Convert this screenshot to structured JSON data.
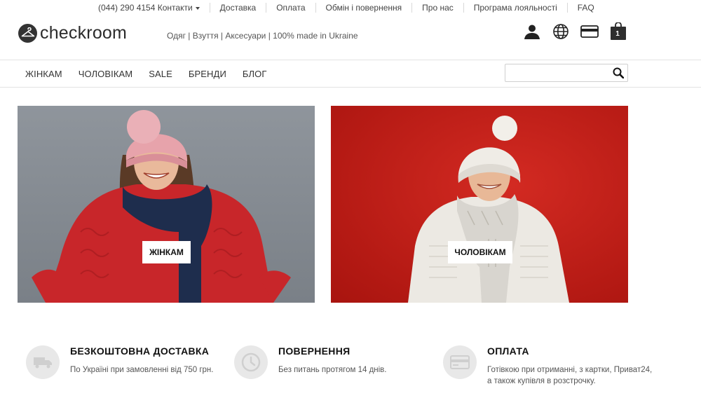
{
  "topbar": {
    "phone": "(044) 290 4154",
    "contacts": "Контакти",
    "links": [
      "Доставка",
      "Оплата",
      "Обмін і повернення",
      "Про нас",
      "Програма лояльності",
      "FAQ"
    ]
  },
  "header": {
    "logo_text": "checkroom",
    "tagline": "Одяг | Взуття | Аксесуари | 100% made in Ukraine",
    "cart_count": "1",
    "icons": [
      "user-icon",
      "globe-icon",
      "card-icon",
      "shopping-bag-icon"
    ]
  },
  "nav": {
    "items": [
      "ЖІНКАМ",
      "ЧОЛОВІКАМ",
      "SALE",
      "БРЕНДИ",
      "БЛОГ"
    ],
    "search_value": ""
  },
  "banners": {
    "women_label": "ЖІНКАМ",
    "men_label": "ЧОЛОВІКАМ"
  },
  "features": [
    {
      "icon": "truck-icon",
      "title": "БЕЗКОШТОВНА ДОСТАВКА",
      "text": "По Україні при замовленні від 750 грн."
    },
    {
      "icon": "clock-icon",
      "title": "ПОВЕРНЕННЯ",
      "text": "Без питань протягом 14 днів."
    },
    {
      "icon": "card-icon",
      "title": "ОПЛАТА",
      "text": "Готівкою при отриманні, з картки, Приват24, а також купівля в розстрочку."
    }
  ],
  "colors": {
    "text": "#333333",
    "women_banner_bg": "#868c93",
    "men_banner_bg": "#c4221b",
    "feature_icon_bg": "#e8e8e8"
  }
}
